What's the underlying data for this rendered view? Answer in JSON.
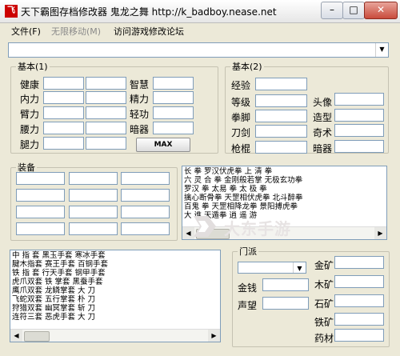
{
  "window": {
    "title": "天下霸图存档修改器 鬼龙之舞 http://k_badboy.nease.net",
    "min_label": "–",
    "max_label": "□",
    "close_label": "✕"
  },
  "menu": {
    "file": "文件(F)",
    "move": "无限移动(M)",
    "visit": "访问游戏修改论坛"
  },
  "top_combo": {
    "value": "",
    "arrow": "▼"
  },
  "basic1": {
    "legend": "基本(1)",
    "labels_left": [
      "健康",
      "内力",
      "臂力",
      "腰力",
      "腿力"
    ],
    "labels_right": [
      "智慧",
      "精力",
      "轻功",
      "暗器"
    ],
    "max_button": "MAX"
  },
  "basic2": {
    "legend": "基本(2)",
    "labels_left": [
      "经验",
      "等级",
      "拳脚",
      "刀剑",
      "枪棍"
    ],
    "labels_right": [
      "头像",
      "造型",
      "奇术",
      "暗器"
    ]
  },
  "equip": {
    "legend": "装备"
  },
  "skills_list": {
    "rows": [
      "长    拳      罗汉伏虎拳    上    清   拳",
      "六 灵     合    拳 金刚般若掌    无极玄功拳",
      "罗汉   拳    太易   拳    太    极   拳",
      "擒心断骨拳     天罡相伏虎拳    北斗醉拳",
      "百鬼    拳    天罡相降龙拳    景阳搏虎拳",
      "大    谁       天遁拳     逍    遥   游"
    ]
  },
  "watermark": {
    "text": "大东手游"
  },
  "items_list": {
    "rows": [
      "中  指  套      黑玉手套        寒冰手套",
      "腱木指套        赛王手套        百钢手套",
      "铁  指  套      行天手套        钢甲手套",
      "虎爪双套        铁  掌套        黑蚕手套",
      "鹰爪双套        龙鳞掌套        大    刀",
      "飞蛇双套        五行掌套        朴    刀",
      "狩猎双套        幽冥掌套        斩    刀",
      "连符三套        恶虎手套        大    刀"
    ]
  },
  "sect": {
    "legend": "门派",
    "combo_value": "",
    "labels_left": [
      "金钱",
      "声望"
    ],
    "labels_right": [
      "金矿",
      "木矿",
      "石矿",
      "铁矿",
      "药材"
    ]
  },
  "colors": {
    "window_bg": "#ece9d8",
    "close_button": "#c94b3c",
    "field_border": "#7f9db9"
  }
}
